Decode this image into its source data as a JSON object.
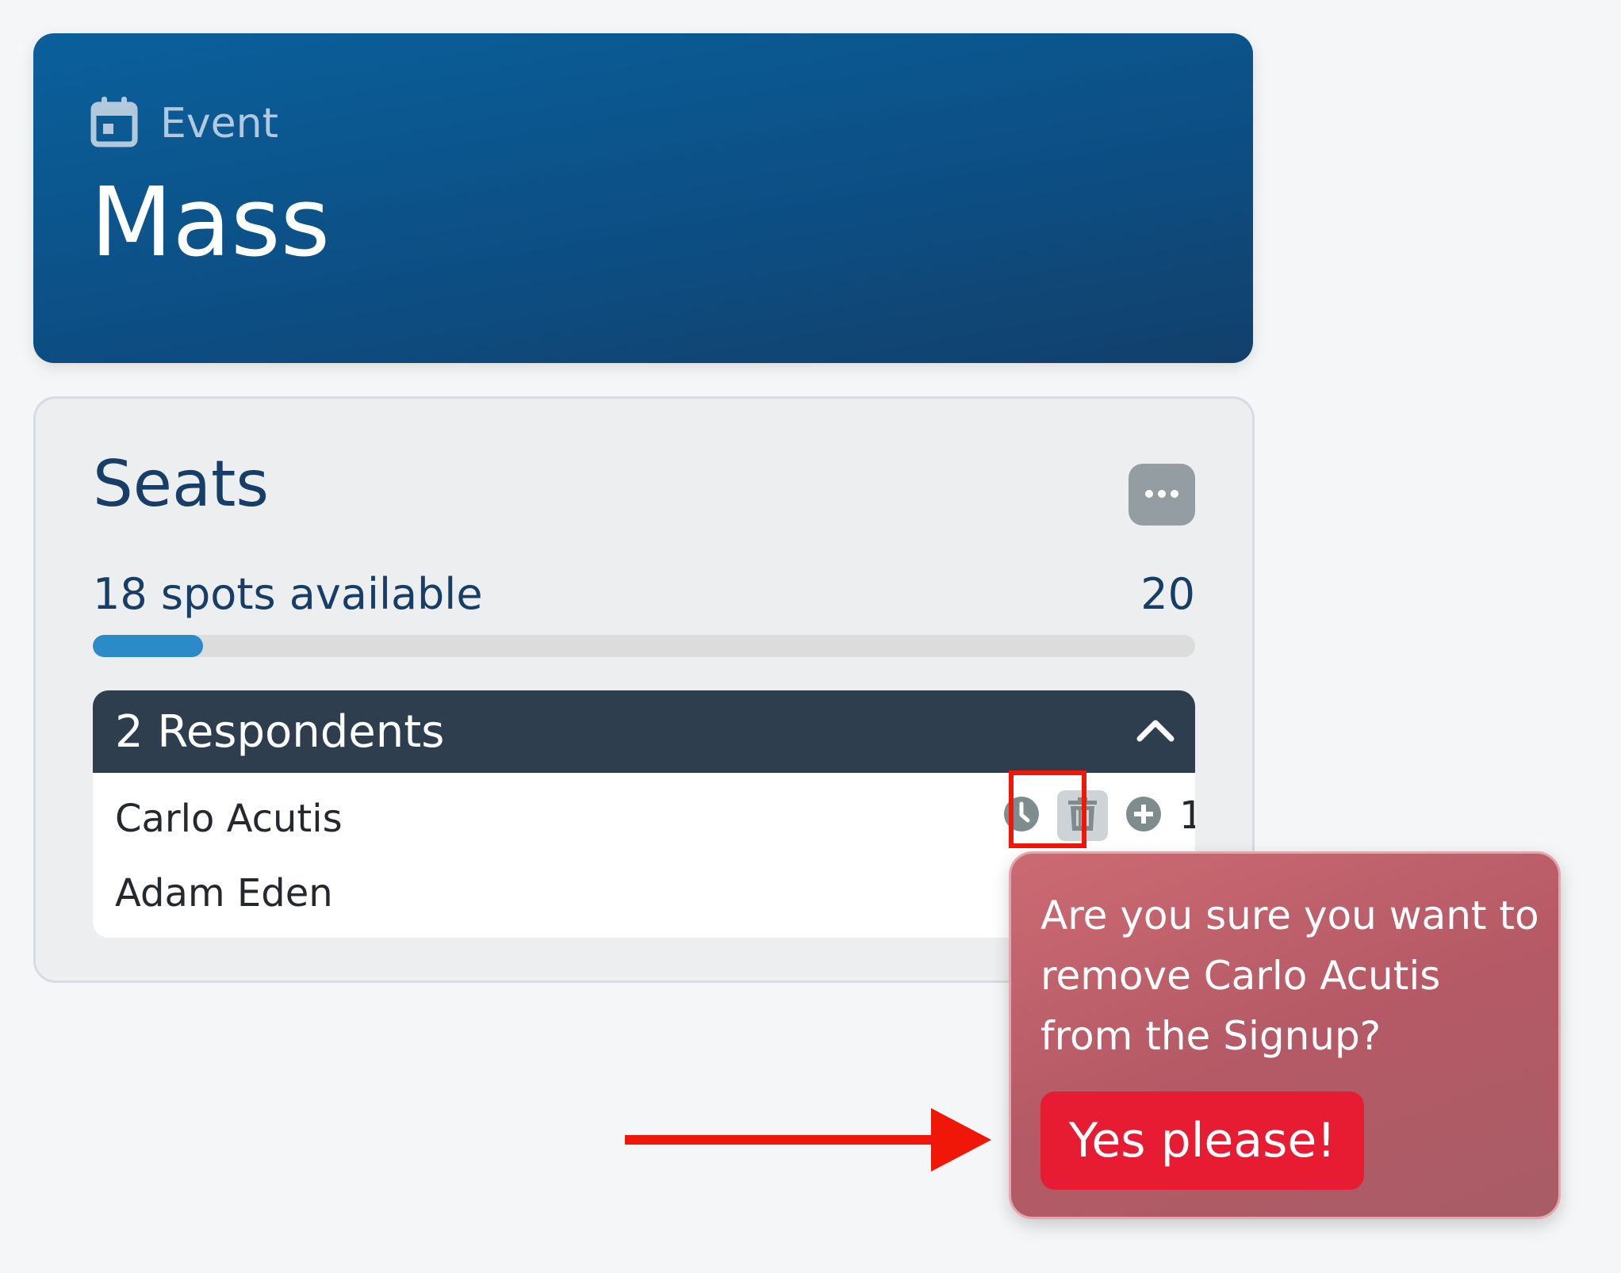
{
  "event": {
    "label": "Event",
    "title": "Mass"
  },
  "seats": {
    "title": "Seats",
    "spots_available": "18 spots available",
    "total": "20",
    "progress_filled_fraction": 0.1,
    "respondents_label": "2 Respondents",
    "respondents": [
      {
        "name": "Carlo Acutis",
        "quantity": "1"
      },
      {
        "name": "Adam Eden"
      }
    ]
  },
  "popover": {
    "message": "Are you sure you want to remove Carlo Acutis from the Signup?",
    "confirm_label": "Yes please!"
  },
  "icons": {
    "event": "calendar-icon",
    "more": "ellipsis-icon",
    "collapse": "chevron-up-icon",
    "time": "clock-icon",
    "remove": "trash-icon",
    "add": "plus-circle-icon"
  },
  "colors": {
    "event_header": "#0c5289",
    "progress": "#2b8ac8",
    "respondents_header": "#2f3e4f",
    "confirm_button": "#e71c32",
    "highlight": "#f01608",
    "annotation_arrow": "#f01608"
  }
}
